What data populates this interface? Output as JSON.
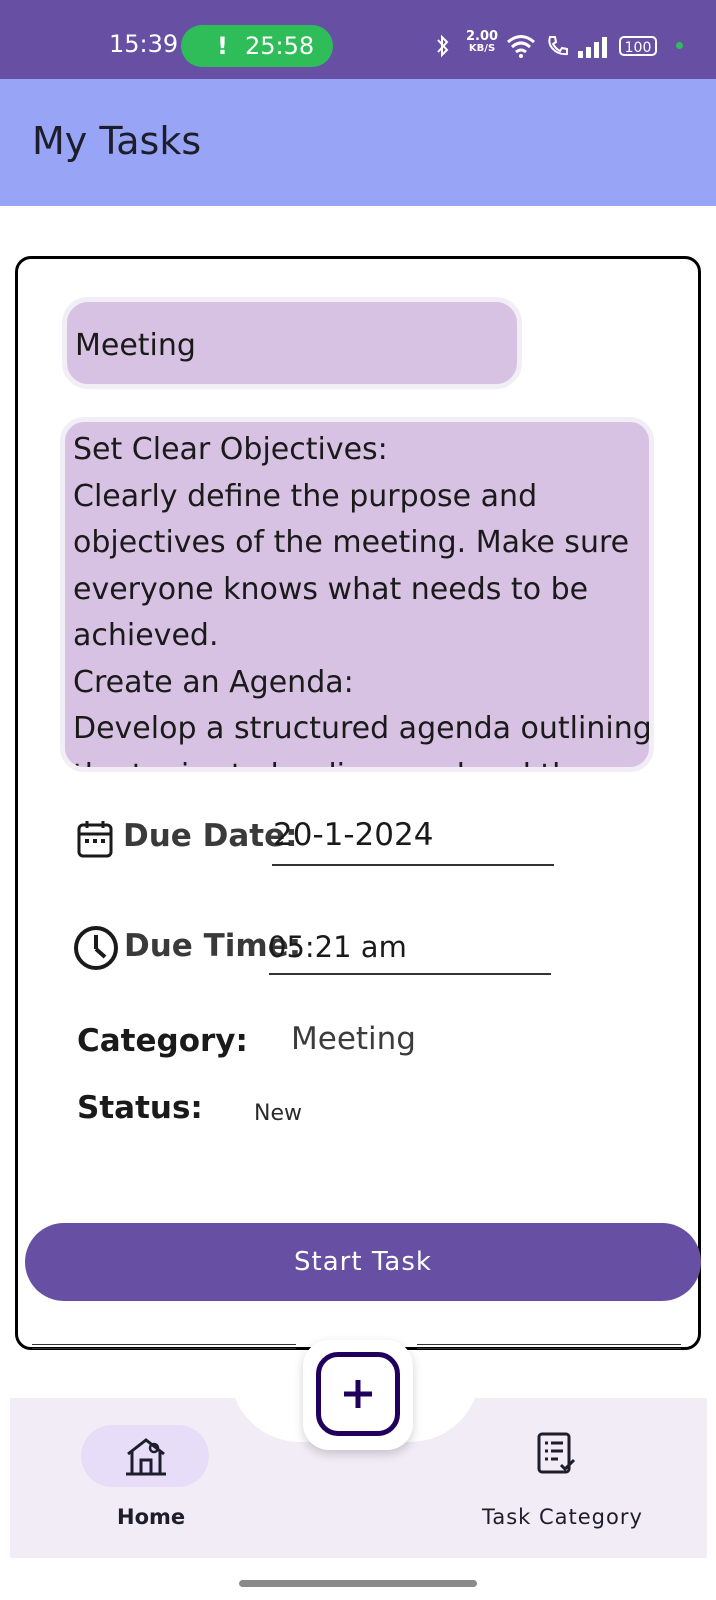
{
  "status_bar": {
    "time": "15:39",
    "call_timer": "25:58",
    "call_indicator": "!",
    "net_speed_value": "2.00",
    "net_speed_unit": "KB/S",
    "battery": "100",
    "icons": [
      "bluetooth-icon",
      "wifi-icon",
      "wifi-call-icon",
      "signal-icon",
      "battery-icon"
    ]
  },
  "appbar": {
    "title": "My Tasks"
  },
  "task": {
    "title": "Meeting",
    "description": "Set Clear Objectives:\nClearly define the purpose and objectives of the meeting. Make sure everyone knows what needs to be achieved.\nCreate an Agenda:\nDevelop a structured agenda outlining the topics to be discussed and the",
    "due_date_label": "Due Date:",
    "due_date_value": "20-1-2024",
    "due_time_label": "Due Time:",
    "due_time_value": "05:21 am",
    "category_label": "Category:",
    "category_value": "Meeting",
    "status_label": "Status:",
    "status_value": "New",
    "start_button": "Start Task"
  },
  "bottom_nav": {
    "items": [
      {
        "label": "Home",
        "icon": "home-icon",
        "active": true
      },
      {
        "label": "Task Category",
        "icon": "checklist-icon",
        "active": false
      }
    ],
    "fab_icon": "add-icon"
  },
  "colors": {
    "status_bar": "#6750a4",
    "app_bar": "#98a5f6",
    "text_box": "#d8c2e3",
    "primary_button": "#6750a4",
    "nav_background": "#f1ecf6",
    "nav_active_pill": "#e8ddf8"
  }
}
